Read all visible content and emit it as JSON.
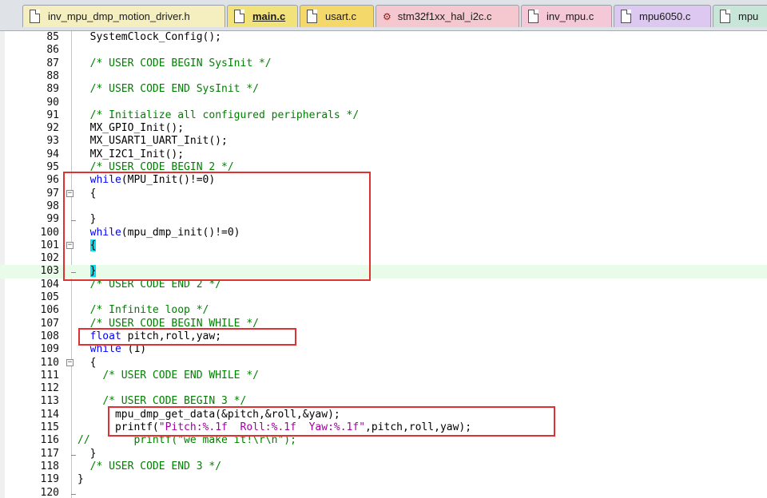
{
  "tabs": [
    {
      "label": "inv_mpu_dmp_motion_driver.h",
      "active": false,
      "color": "#f5efc0",
      "icon": "header-file-icon"
    },
    {
      "label": "main.c",
      "active": true,
      "color": "#f2e27a",
      "icon": "c-file-icon"
    },
    {
      "label": "usart.c",
      "active": false,
      "color": "#f5d86a",
      "icon": "c-file-icon"
    },
    {
      "label": "stm32f1xx_hal_i2c.c",
      "active": false,
      "color": "#f5c8d0",
      "icon": "gear-file-icon"
    },
    {
      "label": "inv_mpu.c",
      "active": false,
      "color": "#f5c8d8",
      "icon": "c-file-icon"
    },
    {
      "label": "mpu6050.c",
      "active": false,
      "color": "#dcc8f0",
      "icon": "c-file-icon"
    },
    {
      "label": "mpu",
      "active": false,
      "color": "#c8e6d8",
      "icon": "c-file-icon"
    }
  ],
  "editor": {
    "lines": [
      {
        "num": "85",
        "code": "  SystemClock_Config();"
      },
      {
        "num": "86",
        "code": ""
      },
      {
        "num": "87",
        "code": "  /* USER CODE BEGIN SysInit */"
      },
      {
        "num": "88",
        "code": ""
      },
      {
        "num": "89",
        "code": "  /* USER CODE END SysInit */"
      },
      {
        "num": "90",
        "code": ""
      },
      {
        "num": "91",
        "code": "  /* Initialize all configured peripherals */"
      },
      {
        "num": "92",
        "code": "  MX_GPIO_Init();"
      },
      {
        "num": "93",
        "code": "  MX_USART1_UART_Init();"
      },
      {
        "num": "94",
        "code": "  MX_I2C1_Init();"
      },
      {
        "num": "95",
        "code": "  /* USER CODE BEGIN 2 */"
      },
      {
        "num": "96",
        "code": "  while(MPU_Init()!=0)"
      },
      {
        "num": "97",
        "code": "  {"
      },
      {
        "num": "98",
        "code": ""
      },
      {
        "num": "99",
        "code": "  }"
      },
      {
        "num": "100",
        "code": "  while(mpu_dmp_init()!=0)"
      },
      {
        "num": "101",
        "code": "  {"
      },
      {
        "num": "102",
        "code": ""
      },
      {
        "num": "103",
        "code": "  }"
      },
      {
        "num": "104",
        "code": "  /* USER CODE END 2 */"
      },
      {
        "num": "105",
        "code": ""
      },
      {
        "num": "106",
        "code": "  /* Infinite loop */"
      },
      {
        "num": "107",
        "code": "  /* USER CODE BEGIN WHILE */"
      },
      {
        "num": "108",
        "code": "  float pitch,roll,yaw;"
      },
      {
        "num": "109",
        "code": "  while (1)"
      },
      {
        "num": "110",
        "code": "  {"
      },
      {
        "num": "111",
        "code": "    /* USER CODE END WHILE */"
      },
      {
        "num": "112",
        "code": ""
      },
      {
        "num": "113",
        "code": "    /* USER CODE BEGIN 3 */"
      },
      {
        "num": "114",
        "code": "      mpu_dmp_get_data(&pitch,&roll,&yaw);"
      },
      {
        "num": "115",
        "code": "      printf(\"Pitch:%.1f  Roll:%.1f  Yaw:%.1f\",pitch,roll,yaw);"
      },
      {
        "num": "116",
        "code": "//       printf(\"we make it!\\r\\n\");"
      },
      {
        "num": "117",
        "code": "  }"
      },
      {
        "num": "118",
        "code": "  /* USER CODE END 3 */"
      },
      {
        "num": "119",
        "code": "}"
      },
      {
        "num": "120",
        "code": ""
      }
    ],
    "current_line": "103",
    "fold_open_lines": [
      "97",
      "101",
      "110"
    ],
    "fold_close_lines": [
      "99",
      "103",
      "117",
      "120"
    ],
    "highlight_boxes": [
      {
        "from": "96",
        "to": "103",
        "label": "init-loops-box"
      },
      {
        "from": "108",
        "to": "108",
        "label": "declaration-box"
      },
      {
        "from": "114",
        "to": "115",
        "label": "print-data-box"
      }
    ],
    "colors": {
      "keyword": "#0000ff",
      "comment": "#008000",
      "string": "#a000a0",
      "box": "#e03030"
    }
  }
}
